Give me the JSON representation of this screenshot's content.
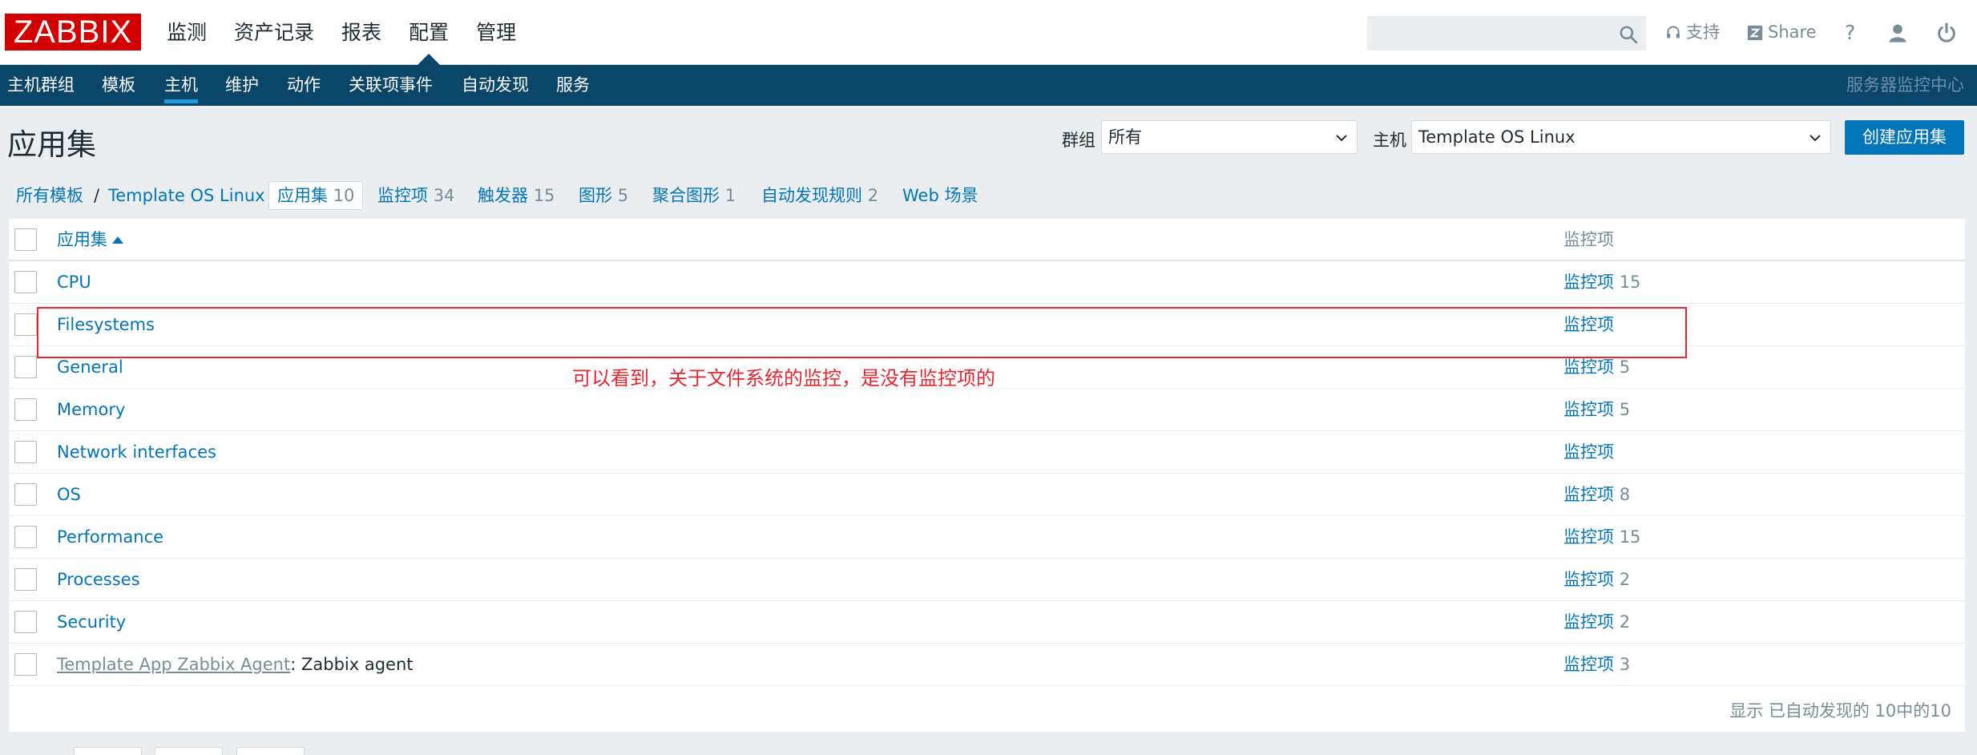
{
  "logo": "ZABBIX",
  "main_menu": [
    {
      "label": "监测",
      "active": false
    },
    {
      "label": "资产记录",
      "active": false
    },
    {
      "label": "报表",
      "active": false
    },
    {
      "label": "配置",
      "active": true
    },
    {
      "label": "管理",
      "active": false
    }
  ],
  "header": {
    "search_value": "",
    "support_label": "支持",
    "share_label": "Share",
    "help_label": "?"
  },
  "sub_menu": [
    {
      "label": "主机群组",
      "active": false
    },
    {
      "label": "模板",
      "active": false
    },
    {
      "label": "主机",
      "active": true
    },
    {
      "label": "维护",
      "active": false
    },
    {
      "label": "动作",
      "active": false
    },
    {
      "label": "关联项事件",
      "active": false
    },
    {
      "label": "自动发现",
      "active": false
    },
    {
      "label": "服务",
      "active": false
    }
  ],
  "server_name": "服务器监控中心",
  "page": {
    "title": "应用集",
    "group_label": "群组",
    "group_value": "所有",
    "host_label": "主机",
    "host_value": "Template OS Linux",
    "create_button": "创建应用集"
  },
  "breadcrumbs": {
    "all_templates": "所有模板",
    "separator": "/",
    "template": "Template OS Linux",
    "tabs": [
      {
        "label": "应用集",
        "count": "10",
        "selected": true
      },
      {
        "label": "监控项",
        "count": "34",
        "selected": false
      },
      {
        "label": "触发器",
        "count": "15",
        "selected": false
      },
      {
        "label": "图形",
        "count": "5",
        "selected": false
      },
      {
        "label": "聚合图形",
        "count": "1",
        "selected": false
      },
      {
        "label": "自动发现规则",
        "count": "2",
        "selected": false
      },
      {
        "label": "Web 场景",
        "count": "",
        "selected": false
      }
    ]
  },
  "table": {
    "col_name": "应用集",
    "col_items": "监控项",
    "rows": [
      {
        "name": "CPU",
        "items_label": "监控项",
        "items_count": "15"
      },
      {
        "name": "Filesystems",
        "items_label": "监控项",
        "items_count": ""
      },
      {
        "name": "General",
        "items_label": "监控项",
        "items_count": "5"
      },
      {
        "name": "Memory",
        "items_label": "监控项",
        "items_count": "5"
      },
      {
        "name": "Network interfaces",
        "items_label": "监控项",
        "items_count": ""
      },
      {
        "name": "OS",
        "items_label": "监控项",
        "items_count": "8"
      },
      {
        "name": "Performance",
        "items_label": "监控项",
        "items_count": "15"
      },
      {
        "name": "Processes",
        "items_label": "监控项",
        "items_count": "2"
      },
      {
        "name": "Security",
        "items_label": "监控项",
        "items_count": "2"
      },
      {
        "name": "Zabbix agent",
        "prefix": "Template App Zabbix Agent",
        "items_label": "监控项",
        "items_count": "3"
      }
    ],
    "footer": "显示 已自动发现的 10中的10"
  },
  "annotation": {
    "text": "可以看到，关于文件系统的监控，是没有监控项的",
    "color": "#e62630"
  },
  "colors": {
    "brand_red": "#d40000",
    "nav_blue": "#0a466a",
    "link_blue": "#0275b8",
    "muted_gray": "#768d99"
  }
}
